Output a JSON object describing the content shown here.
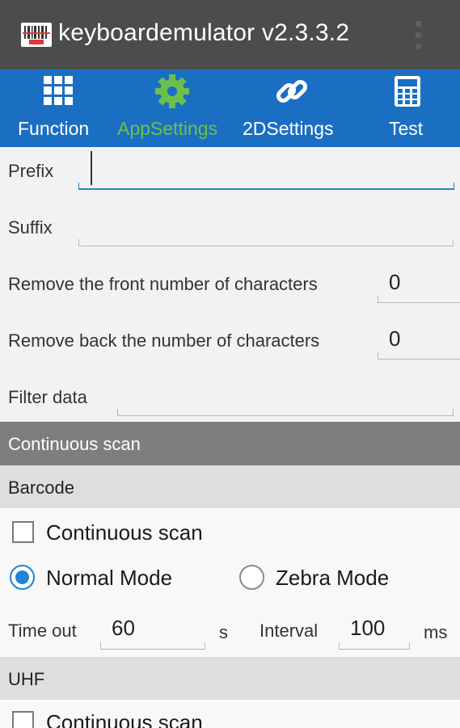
{
  "app": {
    "title": "keyboardemulator v2.3.3.2",
    "icon": "barcode-app-icon",
    "menu_icon": "overflow-menu-icon"
  },
  "tabs": [
    {
      "label": "Function",
      "icon": "grid-icon",
      "active": false
    },
    {
      "label": "AppSettings",
      "icon": "gear-icon",
      "active": true
    },
    {
      "label": "2DSettings",
      "icon": "link-icon",
      "active": false
    },
    {
      "label": "Test",
      "icon": "calculator-icon",
      "active": false
    }
  ],
  "settings": {
    "prefix": {
      "label": "Prefix",
      "value": ""
    },
    "suffix": {
      "label": "Suffix",
      "value": ""
    },
    "remove_front": {
      "label": "Remove the front number of characters",
      "value": "0"
    },
    "remove_back": {
      "label": "Remove back the number of characters",
      "value": "0"
    },
    "filter": {
      "label": "Filter data",
      "value": ""
    }
  },
  "continuous_scan": {
    "header": "Continuous scan",
    "barcode": {
      "header": "Barcode",
      "checkbox_label": "Continuous scan",
      "checked": false,
      "modes": [
        {
          "label": "Normal Mode",
          "selected": true
        },
        {
          "label": "Zebra Mode",
          "selected": false
        }
      ],
      "timeout_label": "Time out",
      "timeout_value": "60",
      "timeout_unit": "s",
      "interval_label": "Interval",
      "interval_value": "100",
      "interval_unit": "ms"
    },
    "uhf": {
      "header": "UHF",
      "checkbox_label": "Continuous scan",
      "checked": false
    }
  },
  "colors": {
    "title_bar": "#4c4c4c",
    "tab_bar": "#1b6fc2",
    "active_tab": "#6cc04a",
    "accent": "#1f84d6",
    "section_header": "#7e7e7e",
    "subsection_header": "#dedede"
  }
}
